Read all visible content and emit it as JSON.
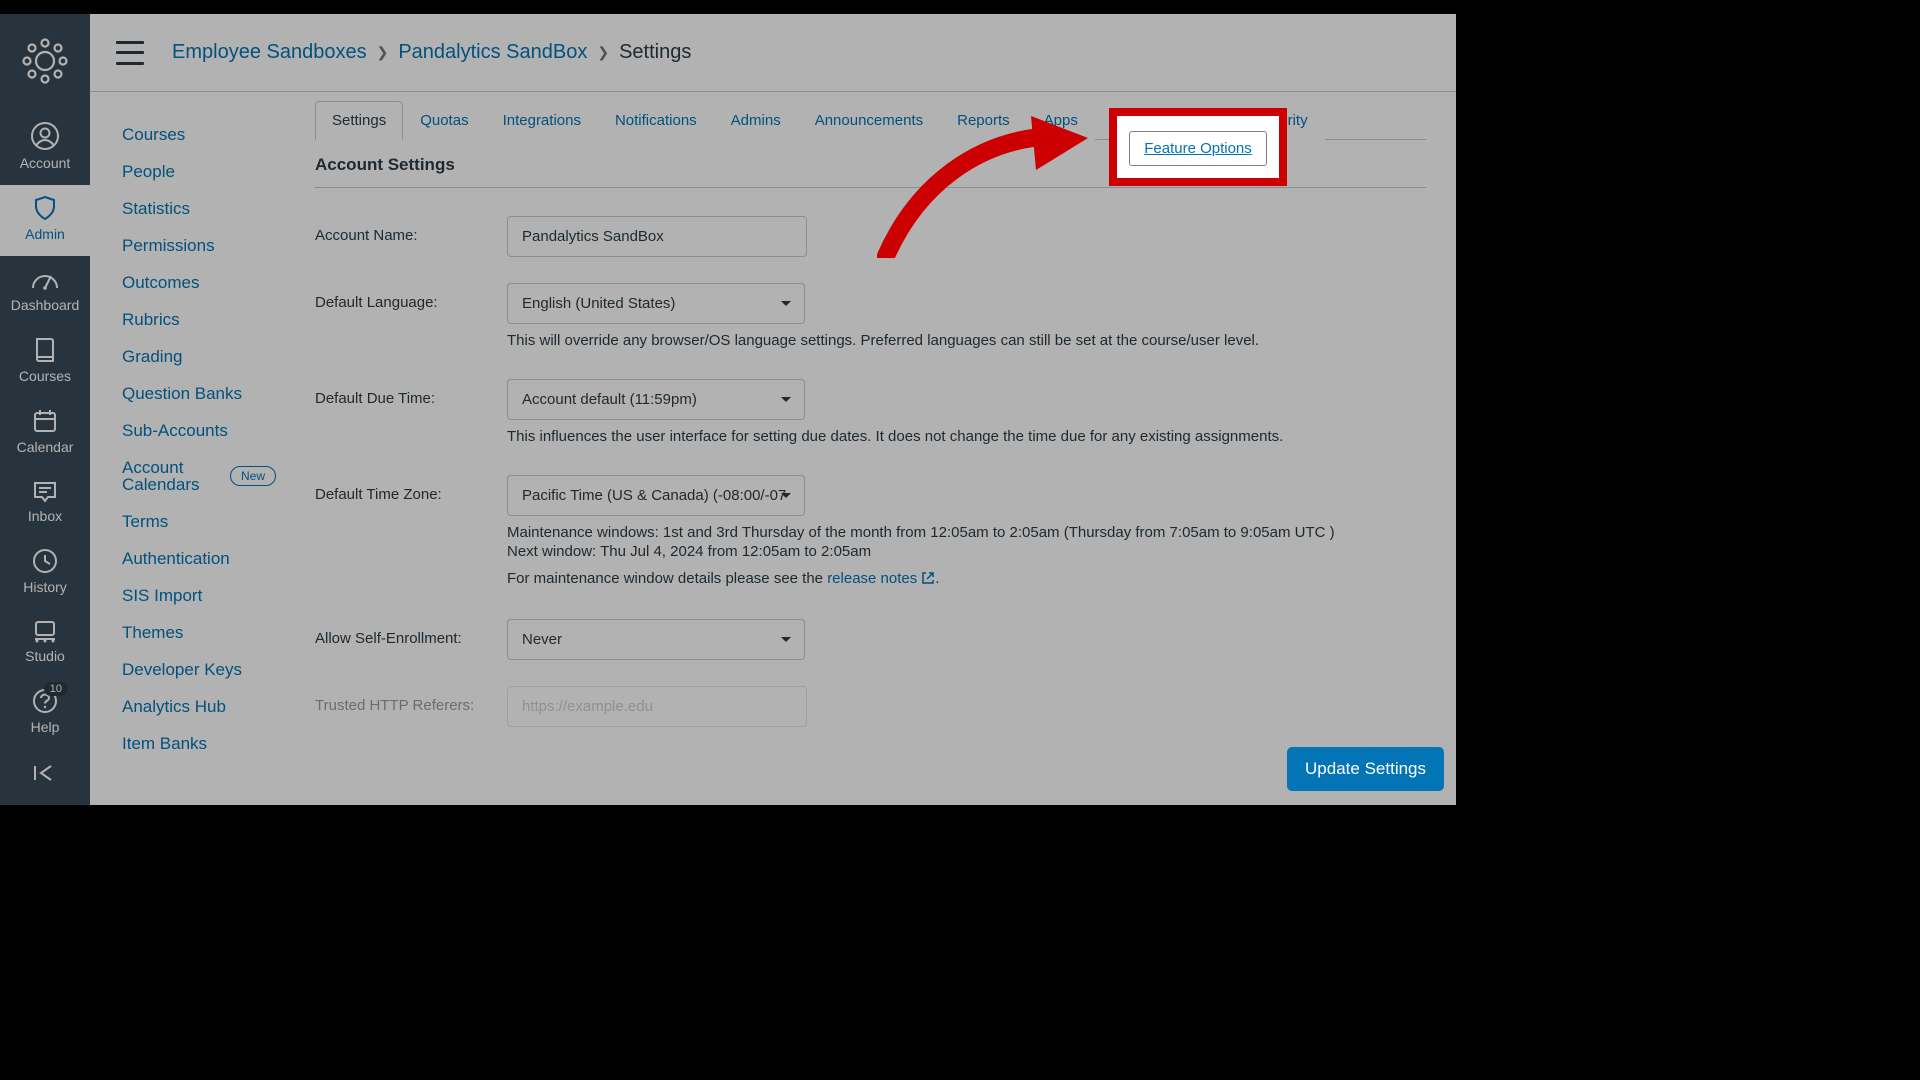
{
  "globalNav": {
    "items": [
      {
        "label": "Account"
      },
      {
        "label": "Admin"
      },
      {
        "label": "Dashboard"
      },
      {
        "label": "Courses"
      },
      {
        "label": "Calendar"
      },
      {
        "label": "Inbox"
      },
      {
        "label": "History"
      },
      {
        "label": "Studio"
      },
      {
        "label": "Help",
        "badge": "10"
      }
    ]
  },
  "breadcrumb": {
    "a": "Employee Sandboxes",
    "b": "Pandalytics SandBox",
    "c": "Settings"
  },
  "secondary": {
    "items": [
      "Courses",
      "People",
      "Statistics",
      "Permissions",
      "Outcomes",
      "Rubrics",
      "Grading",
      "Question Banks",
      "Sub-Accounts",
      "Account Calendars",
      "Terms",
      "Authentication",
      "SIS Import",
      "Themes",
      "Developer Keys",
      "Analytics Hub",
      "Item Banks"
    ],
    "newPill": "New"
  },
  "tabs": [
    "Settings",
    "Quotas",
    "Integrations",
    "Notifications",
    "Admins",
    "Announcements",
    "Reports",
    "Apps",
    "Feature Options",
    "Security"
  ],
  "section": {
    "title": "Account Settings",
    "accountName": {
      "label": "Account Name:",
      "value": "Pandalytics SandBox"
    },
    "defaultLanguage": {
      "label": "Default Language:",
      "value": "English (United States)",
      "help": "This will override any browser/OS language settings. Preferred languages can still be set at the course/user level."
    },
    "defaultDueTime": {
      "label": "Default Due Time:",
      "value": "Account default (11:59pm)",
      "help": "This influences the user interface for setting due dates. It does not change the time due for any existing assignments."
    },
    "defaultTimeZone": {
      "label": "Default Time Zone:",
      "value": "Pacific Time (US & Canada) (-08:00/-07",
      "help1": "Maintenance windows: 1st and 3rd Thursday of the month from 12:05am to 2:05am (Thursday from 7:05am to 9:05am UTC )",
      "help2": "Next window: Thu Jul 4, 2024 from 12:05am to 2:05am",
      "help3a": "For maintenance window details please see the ",
      "help3link": "release notes",
      "help3b": "."
    },
    "selfEnrollment": {
      "label": "Allow Self-Enrollment:",
      "value": "Never"
    },
    "trustedReferers": {
      "label": "Trusted HTTP Referers:",
      "placeholder": "https://example.edu"
    }
  },
  "updateButton": "Update Settings"
}
